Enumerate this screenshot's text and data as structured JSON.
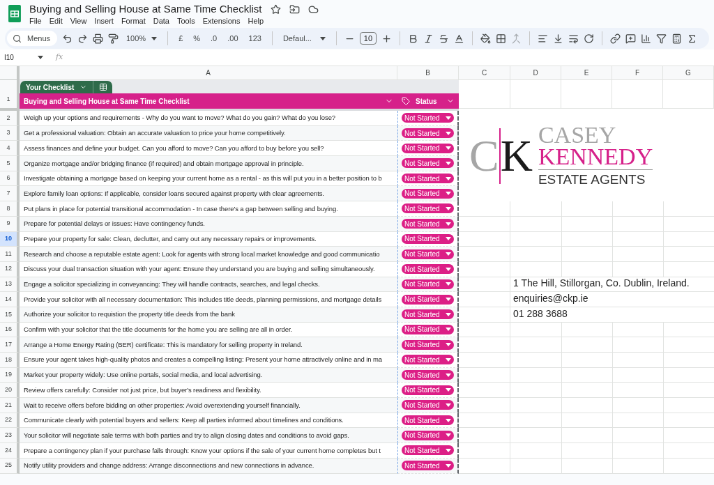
{
  "doc": {
    "title": "Buying and Selling House at Same Time Checklist",
    "menu": [
      "File",
      "Edit",
      "View",
      "Insert",
      "Format",
      "Data",
      "Tools",
      "Extensions",
      "Help"
    ]
  },
  "toolbar": {
    "search": "Menus",
    "zoom": "100%",
    "currency": "£",
    "percent": "%",
    "decrease_decimal": ".0",
    "increase_decimal": ".00",
    "number_format": "123",
    "font": "Defaul...",
    "font_size": "10"
  },
  "formula_bar": {
    "cell": "I10",
    "fx": "fx"
  },
  "columns": [
    "A",
    "B",
    "C",
    "D",
    "E",
    "F",
    "G"
  ],
  "table": {
    "name": "Your Checklist",
    "header_row": "1",
    "headers": [
      "Buying and Selling House at Same Time Checklist",
      "Status"
    ]
  },
  "rows": [
    {
      "num": "2",
      "task": "Weigh up your options and requirements - Why do you want to move? What do you gain? What do you lose?",
      "status": "Not Started",
      "selected": false
    },
    {
      "num": "3",
      "task": "Get a professional valuation: Obtain an accurate valuation to price your home competitively.",
      "status": "Not Started",
      "selected": false
    },
    {
      "num": "4",
      "task": "Assess finances and define your budget. Can you afford to move? Can you afford to buy before you sell?",
      "status": "Not Started",
      "selected": false
    },
    {
      "num": "5",
      "task": "Organize mortgage and/or bridging finance (if required) and obtain mortgage approval in principle.",
      "status": "Not Started",
      "selected": false
    },
    {
      "num": "6",
      "task": "Investigate obtaining a mortgage based on keeping your current home as a rental - as this will put you in a better position to b",
      "status": "Not Started",
      "selected": false
    },
    {
      "num": "7",
      "task": "Explore family loan options: If applicable, consider loans secured against property with clear agreements.",
      "status": "Not Started",
      "selected": false
    },
    {
      "num": "8",
      "task": "Put plans in place for potential transitional accommodation - In case there's a gap between selling and buying.",
      "status": "Not Started",
      "selected": false
    },
    {
      "num": "9",
      "task": "Prepare for potential delays or issues: Have contingency funds.",
      "status": "Not Started",
      "selected": false
    },
    {
      "num": "10",
      "task": "Prepare your property for sale: Clean, declutter, and carry out any necessary repairs or improvements.",
      "status": "Not Started",
      "selected": true
    },
    {
      "num": "11",
      "task": "Research and choose a reputable estate agent: Look for agents with strong local market knowledge and good communicatio",
      "status": "Not Started",
      "selected": false
    },
    {
      "num": "12",
      "task": "Discuss your dual transaction situation with your agent: Ensure they understand you are buying and selling simultaneously.",
      "status": "Not Started",
      "selected": false
    },
    {
      "num": "13",
      "task": "Engage a solicitor specializing in conveyancing: They will handle contracts, searches, and legal checks.",
      "status": "Not Started",
      "selected": false,
      "column_d": "1 The Hill, Stillorgan, Co. Dublin, Ireland."
    },
    {
      "num": "14",
      "task": "Provide your solicitor with all necessary documentation: This includes title deeds, planning permissions, and mortgage details",
      "status": "Not Started",
      "selected": false,
      "column_d": "enquiries@ckp.ie"
    },
    {
      "num": "15",
      "task": "Authorize your solicitor to requistion the property title deeds from the bank",
      "status": "Not Started",
      "selected": false,
      "column_d": "01 288 3688"
    },
    {
      "num": "16",
      "task": "Confirm with your solicitor that the title documents for the home you are selling are all in order.",
      "status": "Not Started",
      "selected": false
    },
    {
      "num": "17",
      "task": "Arrange a Home Energy Rating (BER) certificate: This is mandatory for selling property in Ireland.",
      "status": "Not Started",
      "selected": false
    },
    {
      "num": "18",
      "task": "Ensure your agent takes high-quality photos and creates a compelling listing: Present your home attractively online and in ma",
      "status": "Not Started",
      "selected": false
    },
    {
      "num": "19",
      "task": "Market your property widely: Use online portals, social media, and local advertising.",
      "status": "Not Started",
      "selected": false
    },
    {
      "num": "20",
      "task": "Review offers carefully: Consider not just price, but buyer's readiness and flexibility.",
      "status": "Not Started",
      "selected": false
    },
    {
      "num": "21",
      "task": "Wait to receive offers before bidding on other properties: Avoid overextending yourself financially.",
      "status": "Not Started",
      "selected": false
    },
    {
      "num": "22",
      "task": "Communicate clearly with potential buyers and sellers: Keep all parties informed about timelines and conditions.",
      "status": "Not Started",
      "selected": false
    },
    {
      "num": "23",
      "task": "Your solicitor will negotiate sale terms with both parties and try to align closing dates and conditions to avoid gaps.",
      "status": "Not Started",
      "selected": false
    },
    {
      "num": "24",
      "task": "Prepare a contingency plan if your purchase falls through: Know your options if the sale of your current home completes but t",
      "status": "Not Started",
      "selected": false
    },
    {
      "num": "25",
      "task": "Notify utility providers and change address: Arrange disconnections and new connections in advance.",
      "status": "Not Started",
      "selected": false
    }
  ],
  "logo": {
    "initial_1": "C",
    "initial_2": "K",
    "name_1": "CASEY",
    "name_2": "KENNEDY",
    "tagline": "ESTATE AGENTS"
  }
}
